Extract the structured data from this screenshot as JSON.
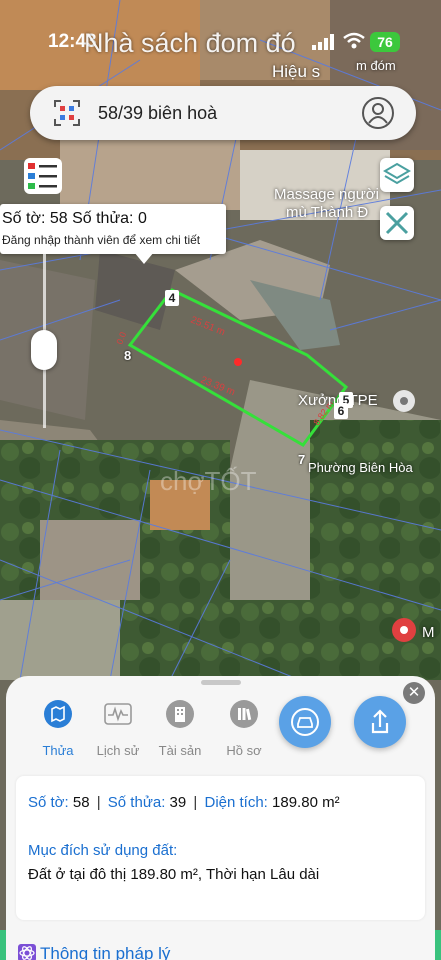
{
  "status_bar": {
    "time": "12:43",
    "banner_text": "Nhà sách đom đó",
    "battery": "76"
  },
  "search": {
    "query": "58/39 biên hoà"
  },
  "map_labels": {
    "poi_top_right": "m đóm",
    "poi_hieu": "Hiệu s",
    "poi_massage_1": "Massage người",
    "poi_massage_2": "mù Thành Đ",
    "poi_xuong": "Xưởng TPE",
    "poi_ward": "Phường Biên Hòa",
    "poi_m": "M",
    "watermark": "chợTỐT",
    "edge_top": "25.51 m",
    "edge_bottom": "23.39 m",
    "edge_left": "0.0",
    "edge_right": "8.82 m",
    "vertex_4": "4",
    "vertex_5": "5",
    "vertex_6": "6",
    "vertex_7": "7",
    "vertex_8": "8"
  },
  "tooltip": {
    "line1": "Số tờ: 58 Số thửa: 0",
    "line2": "Đăng nhập thành viên để xem chi tiết"
  },
  "sheet": {
    "tabs": [
      {
        "label": "Thửa",
        "active": true
      },
      {
        "label": "Lịch sử",
        "active": false
      },
      {
        "label": "Tài sản",
        "active": false
      },
      {
        "label": "Hồ sơ",
        "active": false
      }
    ],
    "close_label": "✕",
    "parcel": {
      "so_to_label": "Số tờ:",
      "so_to_value": "58",
      "so_thua_label": "Số thửa:",
      "so_thua_value": "39",
      "dien_tich_label": "Diện tích:",
      "dien_tich_value": "189.80 m²",
      "muc_dich_label": "Mục đích sử dụng đất:",
      "muc_dich_value": "Đất ở tại đô thị 189.80 m², Thời hạn Lâu dài"
    },
    "legal_label": "Thông tin pháp lý"
  },
  "colors": {
    "accent": "#2a7ed6",
    "parcel_outline": "#35e03a",
    "action_button": "#5aa1e6"
  }
}
